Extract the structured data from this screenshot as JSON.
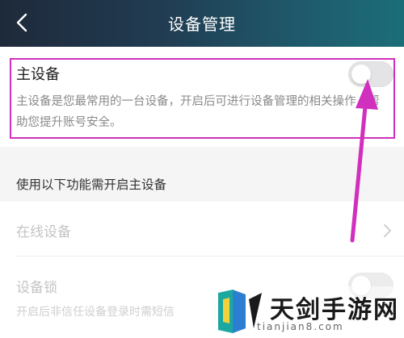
{
  "header": {
    "title": "设备管理",
    "back_icon": "chevron-left-icon"
  },
  "primary_device": {
    "label": "主设备",
    "description": "主设备是您最常用的一台设备，开启后可进行设备管理的相关操作，帮助您提升账号安全。",
    "toggle_on": false
  },
  "features": {
    "caption": "使用以下功能需开启主设备",
    "online_devices_label": "在线设备",
    "device_lock_label": "设备锁",
    "device_lock_description": "开启后非信任设备登录时需短信",
    "device_lock_toggle_on": false
  },
  "watermark": {
    "brand": "天剑手游网",
    "url": "tianjian8.com"
  },
  "colors": {
    "header_gradient_start": "#1e2a3a",
    "header_gradient_end": "#1b6e78",
    "annotation": "#d12fbd"
  }
}
